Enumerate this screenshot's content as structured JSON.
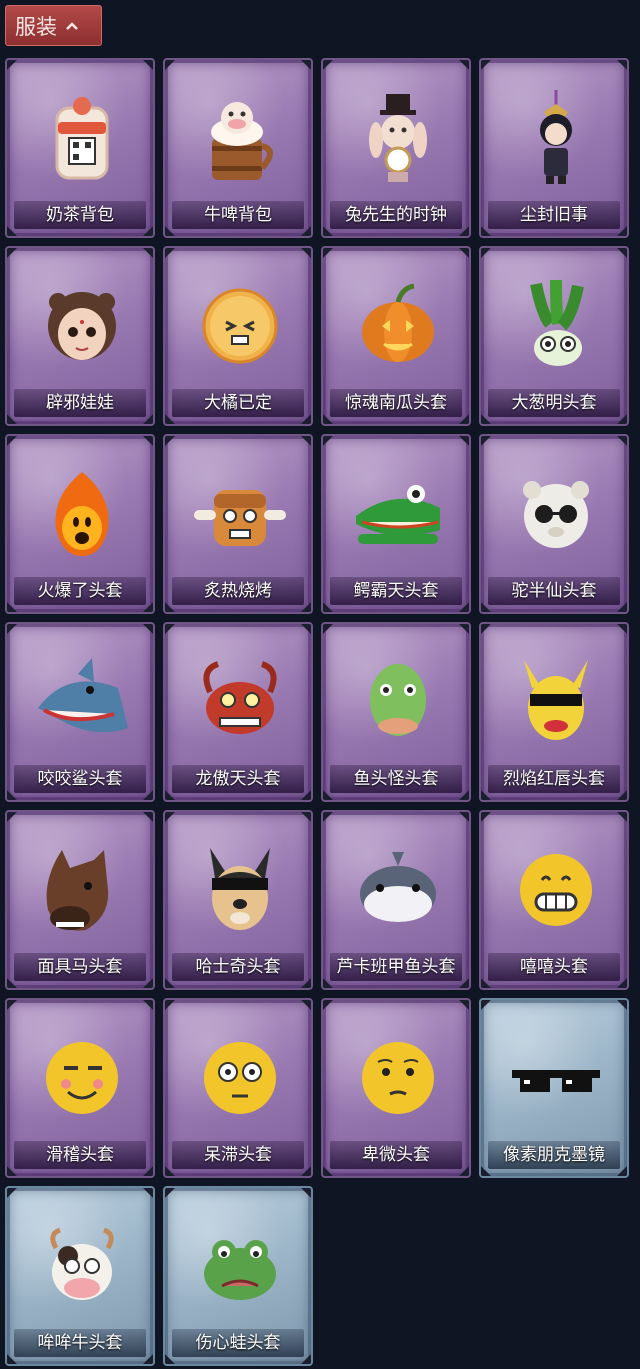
{
  "header": {
    "label": "服装"
  },
  "items": [
    {
      "label": "奶茶背包",
      "rarity": "purple",
      "icon": "milk-tea-backpack-icon"
    },
    {
      "label": "牛啤背包",
      "rarity": "purple",
      "icon": "cow-beer-backpack-icon"
    },
    {
      "label": "兔先生的时钟",
      "rarity": "purple",
      "icon": "mr-rabbit-clock-icon"
    },
    {
      "label": "尘封旧事",
      "rarity": "purple",
      "icon": "doll-charm-icon"
    },
    {
      "label": "辟邪娃娃",
      "rarity": "purple",
      "icon": "doll-head-icon"
    },
    {
      "label": "大橘已定",
      "rarity": "purple",
      "icon": "orange-head-icon"
    },
    {
      "label": "惊魂南瓜头套",
      "rarity": "purple",
      "icon": "pumpkin-head-icon"
    },
    {
      "label": "大葱明头套",
      "rarity": "purple",
      "icon": "scallion-head-icon"
    },
    {
      "label": "火爆了头套",
      "rarity": "purple",
      "icon": "fire-head-icon"
    },
    {
      "label": "炙热烧烤",
      "rarity": "purple",
      "icon": "bbq-head-icon"
    },
    {
      "label": "鳄霸天头套",
      "rarity": "purple",
      "icon": "crocodile-head-icon"
    },
    {
      "label": "驼半仙头套",
      "rarity": "purple",
      "icon": "alpaca-head-icon"
    },
    {
      "label": "咬咬鲨头套",
      "rarity": "purple",
      "icon": "shark-head-icon"
    },
    {
      "label": "龙傲天头套",
      "rarity": "purple",
      "icon": "dragon-head-icon"
    },
    {
      "label": "鱼头怪头套",
      "rarity": "purple",
      "icon": "fish-monster-head-icon"
    },
    {
      "label": "烈焰红唇头套",
      "rarity": "purple",
      "icon": "red-lips-head-icon"
    },
    {
      "label": "面具马头套",
      "rarity": "purple",
      "icon": "horse-mask-icon"
    },
    {
      "label": "哈士奇头套",
      "rarity": "purple",
      "icon": "husky-head-icon"
    },
    {
      "label": "芦卡班甲鱼头套",
      "rarity": "purple",
      "icon": "fish-head-icon"
    },
    {
      "label": "嘻嘻头套",
      "rarity": "purple",
      "icon": "grin-emoji-head-icon"
    },
    {
      "label": "滑稽头套",
      "rarity": "purple",
      "icon": "smirk-emoji-head-icon"
    },
    {
      "label": "呆滞头套",
      "rarity": "purple",
      "icon": "stunned-emoji-head-icon"
    },
    {
      "label": "卑微头套",
      "rarity": "purple",
      "icon": "humble-emoji-head-icon"
    },
    {
      "label": "像素朋克墨镜",
      "rarity": "blue",
      "icon": "pixel-sunglasses-icon"
    },
    {
      "label": "哞哞牛头套",
      "rarity": "blue",
      "icon": "cow-head-icon"
    },
    {
      "label": "伤心蛙头套",
      "rarity": "blue",
      "icon": "sad-frog-head-icon"
    }
  ]
}
